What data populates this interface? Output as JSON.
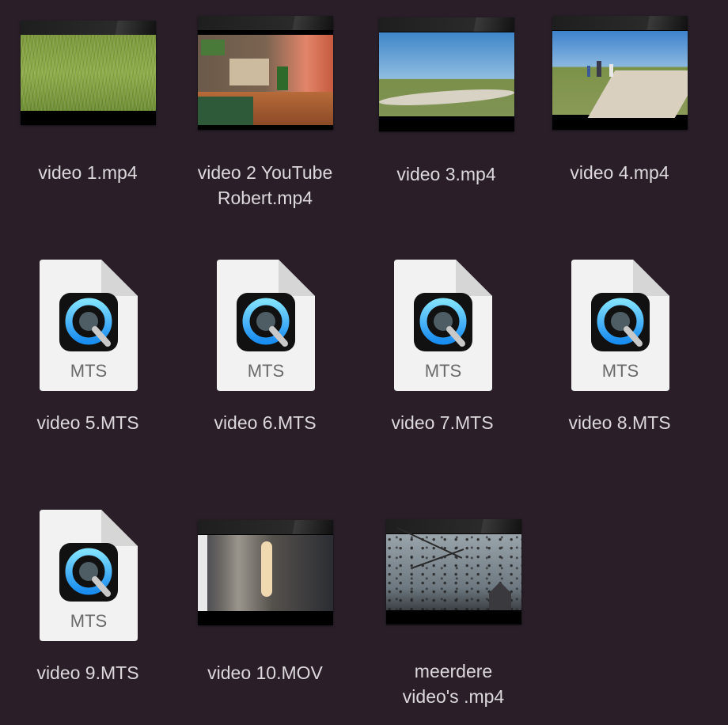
{
  "files": [
    {
      "name": "video 1.mp4",
      "kind": "video-thumbnail",
      "scene": "grass"
    },
    {
      "name": "video 2 YouTube\nRobert.mp4",
      "kind": "video-thumbnail",
      "scene": "lego"
    },
    {
      "name": "video 3.mp4",
      "kind": "video-thumbnail",
      "scene": "path-sky"
    },
    {
      "name": "video 4.mp4",
      "kind": "video-thumbnail",
      "scene": "path-people"
    },
    {
      "name": "video 5.MTS",
      "kind": "document-icon",
      "icon": "quicktime-icon",
      "ext": "MTS"
    },
    {
      "name": "video 6.MTS",
      "kind": "document-icon",
      "icon": "quicktime-icon",
      "ext": "MTS"
    },
    {
      "name": "video 7.MTS",
      "kind": "document-icon",
      "icon": "quicktime-icon",
      "ext": "MTS"
    },
    {
      "name": "video 8.MTS",
      "kind": "document-icon",
      "icon": "quicktime-icon",
      "ext": "MTS"
    },
    {
      "name": "video 9.MTS",
      "kind": "document-icon",
      "icon": "quicktime-icon",
      "ext": "MTS"
    },
    {
      "name": "video 10.MOV",
      "kind": "video-thumbnail",
      "scene": "interior"
    },
    {
      "name": "meerdere\nvideo's .mp4",
      "kind": "video-thumbnail",
      "scene": "rain-branches"
    }
  ],
  "colors": {
    "background": "#2a1f29",
    "label": "#dcd8dc",
    "quicktime_blue": "#1aa7ff"
  }
}
